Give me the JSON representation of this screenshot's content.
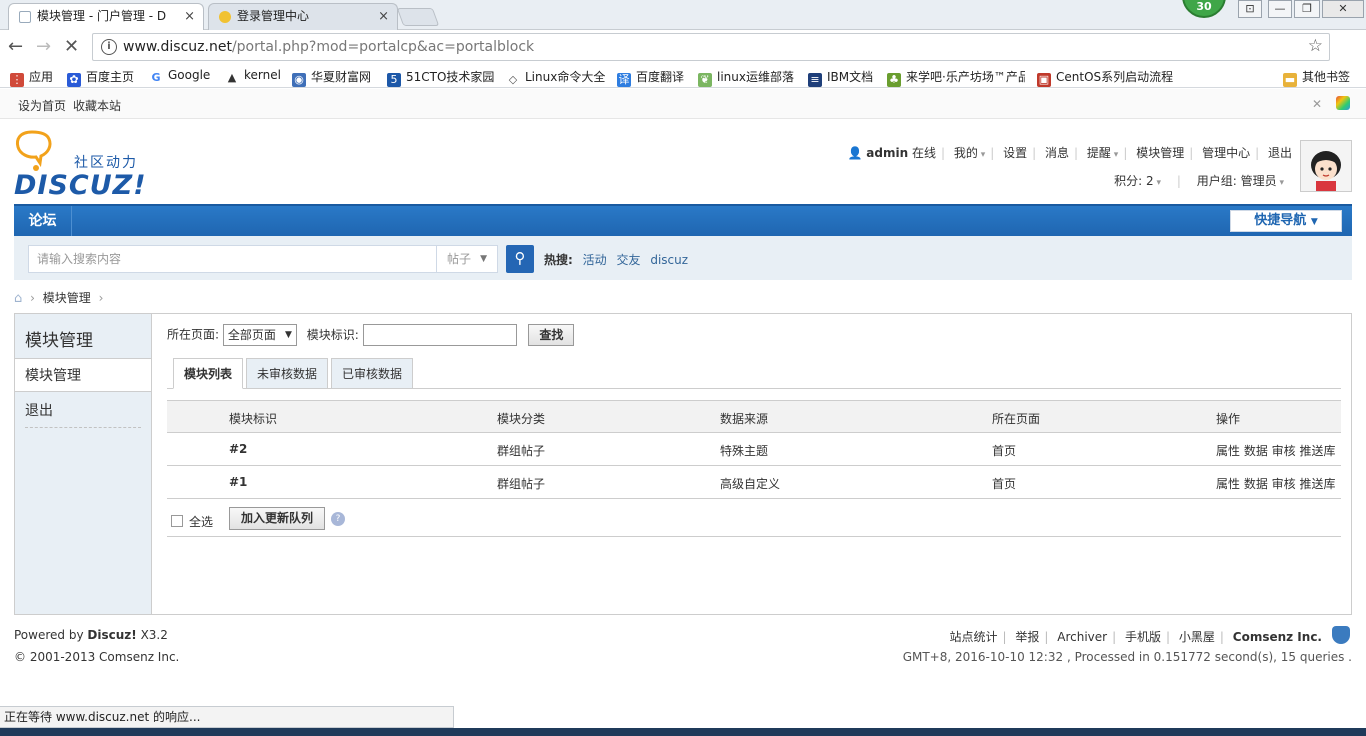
{
  "browser": {
    "tabs": [
      {
        "title": "模块管理 - 门户管理 - D",
        "close": "×",
        "active": true
      },
      {
        "title": "登录管理中心",
        "close": "×",
        "active": false
      }
    ],
    "badge": "30",
    "window_buttons": [
      "⊡",
      "—",
      "❐",
      "✕"
    ],
    "url_host": "www.discuz.net",
    "url_path": "/portal.php?mod=portalcp&ac=portalblock",
    "star": "☆",
    "back": "←",
    "forward": "→",
    "stop": "✕",
    "bookmarks": [
      {
        "label": "应用",
        "icon": "apps-icon",
        "color": "#d04a3a"
      },
      {
        "label": "百度主页",
        "icon": "baidu-paw-icon",
        "color": "#2a5bd7"
      },
      {
        "label": "Google",
        "icon": "google-icon",
        "color": "#4285f4"
      },
      {
        "label": "kernel",
        "icon": "tux-icon",
        "color": "#333333"
      },
      {
        "label": "华夏财富网",
        "icon": "globe-icon",
        "color": "#3f6fb8"
      },
      {
        "label": "51CTO技术家园",
        "icon": "cto-icon",
        "color": "#1d58a8"
      },
      {
        "label": "Linux命令大全",
        "icon": "diamond-icon",
        "color": "#555555"
      },
      {
        "label": "百度翻译",
        "icon": "translate-icon",
        "color": "#2e7de0"
      },
      {
        "label": "linux运维部落",
        "icon": "leaf-icon",
        "color": "#7bb661"
      },
      {
        "label": "IBM文档",
        "icon": "ibm-icon",
        "color": "#1f3f7a"
      },
      {
        "label": "来学吧·乐产坊场™产品",
        "icon": "sprout-icon",
        "color": "#6a9e2f"
      },
      {
        "label": "CentOS系列启动流程",
        "icon": "centos-icon",
        "color": "#c0392b"
      },
      {
        "label": "其他书签",
        "icon": "folder-icon",
        "color": "#e8b23a"
      }
    ]
  },
  "topstrip": {
    "set_home": "设为首页",
    "favorite": "收藏本站"
  },
  "header": {
    "logo_sub": "社区动力",
    "logo_main": "DISCUZ!",
    "username": "admin",
    "online": "在线",
    "nav": [
      "我的",
      "设置",
      "消息",
      "提醒",
      "模块管理",
      "管理中心",
      "退出"
    ],
    "points": "积分: 2",
    "usergroup": "用户组: 管理员"
  },
  "navbar": {
    "forum": "论坛",
    "quick_nav": "快捷导航"
  },
  "search": {
    "placeholder": "请输入搜索内容",
    "type": "帖子",
    "hot_label": "热搜:",
    "hot": [
      "活动",
      "交友",
      "discuz"
    ]
  },
  "breadcrumb": {
    "current": "模块管理"
  },
  "sidebar": {
    "title": "模块管理",
    "items": [
      "模块管理",
      "退出"
    ]
  },
  "filter": {
    "page_label": "所在页面:",
    "page_value": "全部页面",
    "id_label": "模块标识:",
    "search_btn": "查找"
  },
  "tabs": [
    "模块列表",
    "未审核数据",
    "已审核数据"
  ],
  "table": {
    "headers": [
      "模块标识",
      "模块分类",
      "数据来源",
      "所在页面",
      "操作"
    ],
    "rows": [
      {
        "id": "#2",
        "category": "群组帖子",
        "source": "特殊主题",
        "page": "首页",
        "ops": "属性 数据 审核 推送库"
      },
      {
        "id": "#1",
        "category": "群组帖子",
        "source": "高级自定义",
        "page": "首页",
        "ops": "属性 数据 审核 推送库"
      }
    ]
  },
  "footer_actions": {
    "select_all": "全选",
    "add_queue": "加入更新队列",
    "help": "?"
  },
  "footer": {
    "powered": "Powered by",
    "product": "Discuz!",
    "version": "X3.2",
    "copyright": "© 2001-2013 Comsenz Inc.",
    "links": [
      "站点统计",
      "举报",
      "Archiver",
      "手机版",
      "小黑屋"
    ],
    "company": "Comsenz Inc.",
    "stats": "GMT+8, 2016-10-10 12:32 , Processed in 0.151772 second(s), 15 queries ."
  },
  "status_text": "正在等待 www.discuz.net 的响应..."
}
